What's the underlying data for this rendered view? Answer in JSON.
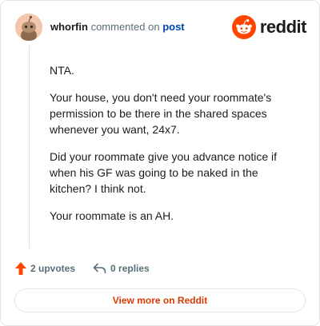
{
  "comment": {
    "username": "whorfin",
    "action_text": "commented on",
    "target_text": "post",
    "paragraphs": [
      "NTA.",
      "Your house, you don't need your roommate's permission to be there in the shared spaces whenever you want, 24x7.",
      "Did your roommate give you advance notice if when his GF was going to be naked in the kitchen? I think not.",
      "Your roommate is an AH."
    ]
  },
  "brand": {
    "wordmark": "reddit",
    "icon": "reddit-snoo-icon",
    "color": "#ff4500"
  },
  "actions": {
    "upvotes_label": "2 upvotes",
    "replies_label": "0 replies",
    "upvote_icon": "upvote-arrow-icon",
    "reply_icon": "reply-arrow-icon",
    "upvote_color": "#ff4500"
  },
  "footer": {
    "view_more_label": "View more on Reddit"
  },
  "colors": {
    "accent": "#d93a00",
    "link": "#0045ac",
    "meta": "#576f76"
  }
}
